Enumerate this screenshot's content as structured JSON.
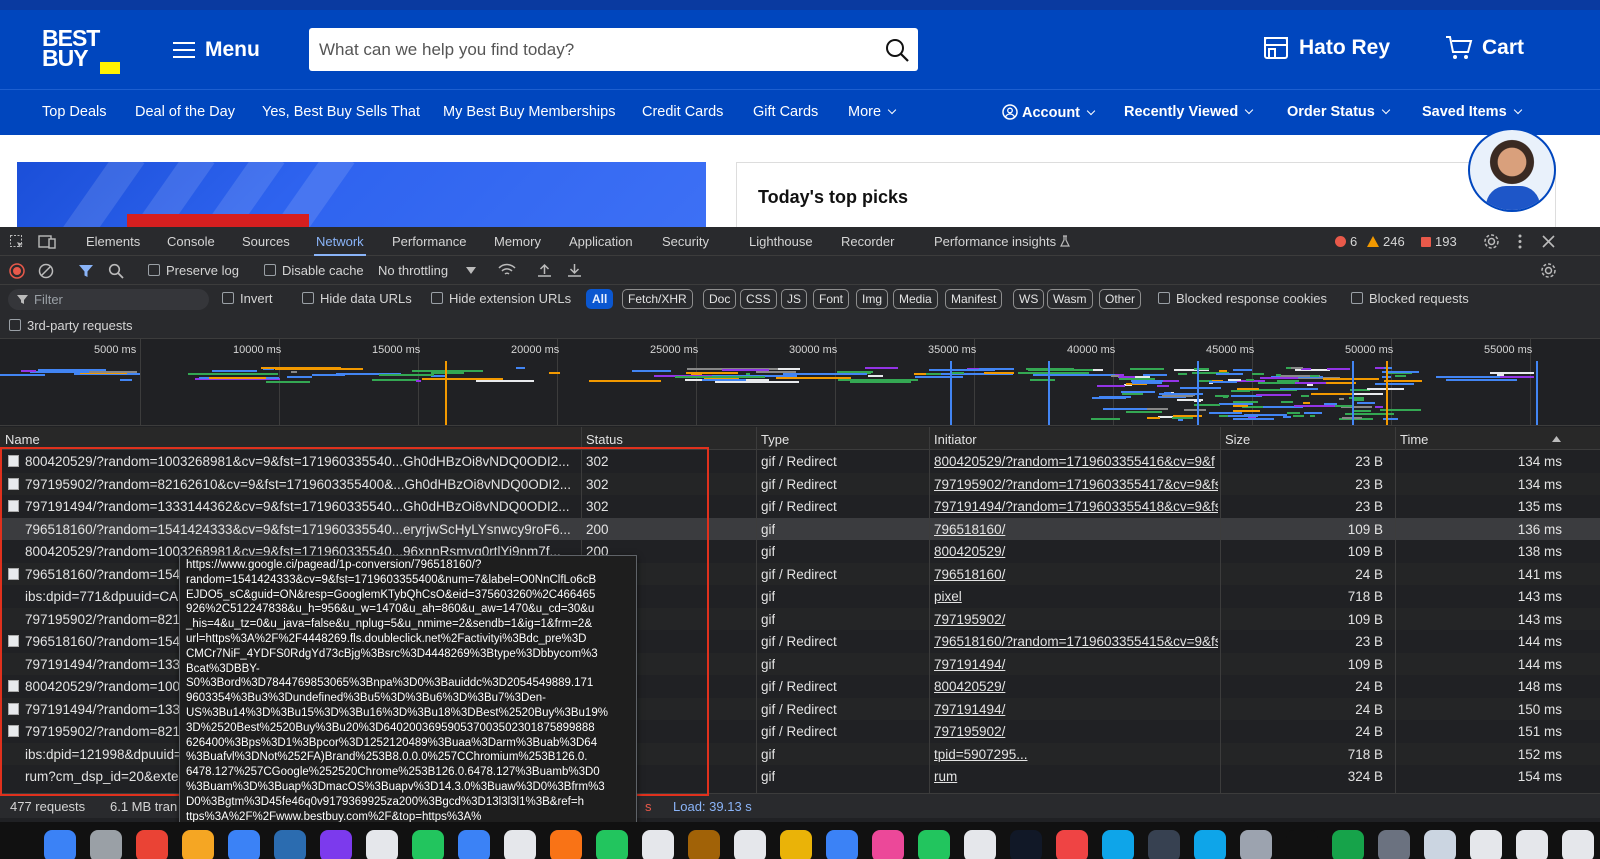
{
  "site": {
    "logo_line1": "BEST",
    "logo_line2": "BUY",
    "menu_label": "Menu",
    "search_placeholder": "What can we help you find today?",
    "store_label": "Hato Rey",
    "cart_label": "Cart",
    "nav_items": [
      "Top Deals",
      "Deal of the Day",
      "Yes, Best Buy Sells That",
      "My Best Buy Memberships",
      "Credit Cards",
      "Gift Cards",
      "More"
    ],
    "account_items": [
      "Account",
      "Recently Viewed",
      "Order Status",
      "Saved Items"
    ],
    "top_picks_title": "Today's top picks",
    "brand_colors": {
      "blue": "#0046be",
      "yellow": "#fff200"
    }
  },
  "devtools": {
    "tabs": [
      "Elements",
      "Console",
      "Sources",
      "Network",
      "Performance",
      "Memory",
      "Application",
      "Security",
      "Lighthouse",
      "Recorder",
      "Performance insights"
    ],
    "active_tab": "Network",
    "counts": {
      "errors": "6",
      "warnings": "246",
      "issues": "193"
    },
    "toolbar": {
      "preserve_log": "Preserve log",
      "disable_cache": "Disable cache",
      "throttling": "No throttling"
    },
    "filter": {
      "placeholder": "Filter",
      "invert": "Invert",
      "hide_data_urls": "Hide data URLs",
      "hide_extension_urls": "Hide extension URLs",
      "types": [
        "All",
        "Fetch/XHR",
        "Doc",
        "CSS",
        "JS",
        "Font",
        "Img",
        "Media",
        "Manifest",
        "WS",
        "Wasm",
        "Other"
      ],
      "active_type": "All",
      "blocked_response_cookies": "Blocked response cookies",
      "blocked_requests": "Blocked requests",
      "third_party": "3rd-party requests"
    },
    "overview_ticks": [
      "5000 ms",
      "10000 ms",
      "15000 ms",
      "20000 ms",
      "25000 ms",
      "30000 ms",
      "35000 ms",
      "40000 ms",
      "45000 ms",
      "50000 ms",
      "55000 ms"
    ],
    "columns": {
      "name": "Name",
      "status": "Status",
      "type": "Type",
      "initiator": "Initiator",
      "size": "Size",
      "time": "Time"
    },
    "rows": [
      {
        "name": "800420529/?random=1003268981&cv=9&fst=171960335540...Gh0dHBzOi8vNDQ0ODI2...",
        "status": "302",
        "type": "gif / Redirect",
        "initiator": "800420529/?random=1719603355416&cv=9&f",
        "size": "23 B",
        "time": "134 ms",
        "icon": true
      },
      {
        "name": "797195902/?random=82162610&cv=9&fst=1719603355400&...Gh0dHBzOi8vNDQ0ODI2...",
        "status": "302",
        "type": "gif / Redirect",
        "initiator": "797195902/?random=1719603355417&cv=9&fs",
        "size": "23 B",
        "time": "134 ms",
        "icon": true
      },
      {
        "name": "797191494/?random=1333144362&cv=9&fst=171960335540...Gh0dHBzOi8vNDQ0ODI2...",
        "status": "302",
        "type": "gif / Redirect",
        "initiator": "797191494/?random=1719603355418&cv=9&fs",
        "size": "23 B",
        "time": "135 ms",
        "icon": true
      },
      {
        "name": "796518160/?random=1541424333&cv=9&fst=171960335540...eryrjwScHyLYsnwcy9roF6...",
        "status": "200",
        "type": "gif",
        "initiator": "796518160/",
        "size": "109 B",
        "time": "136 ms",
        "icon": false
      },
      {
        "name": "800420529/?random=1003268981&cv=9&fst=171960335540...96xnnRsmvq0rtlYi9nm7f...",
        "status": "200",
        "type": "gif",
        "initiator": "800420529/",
        "size": "109 B",
        "time": "138 ms",
        "icon": false
      },
      {
        "name": "796518160/?random=154",
        "status": "",
        "type": "gif / Redirect",
        "initiator": "796518160/",
        "size": "24 B",
        "time": "141 ms",
        "icon": true
      },
      {
        "name": "ibs:dpid=771&dpuuid=CA",
        "status": "",
        "type": "gif",
        "initiator": "pixel",
        "size": "718 B",
        "time": "143 ms",
        "icon": false
      },
      {
        "name": "797195902/?random=821",
        "status": "",
        "type": "gif",
        "initiator": "797195902/",
        "size": "109 B",
        "time": "143 ms",
        "icon": false
      },
      {
        "name": "796518160/?random=154",
        "status": "",
        "type": "gif / Redirect",
        "initiator": "796518160/?random=1719603355415&cv=9&fs",
        "size": "23 B",
        "time": "144 ms",
        "icon": true
      },
      {
        "name": "797191494/?random=133",
        "status": "",
        "type": "gif",
        "initiator": "797191494/",
        "size": "109 B",
        "time": "144 ms",
        "icon": false
      },
      {
        "name": "800420529/?random=100",
        "status": "",
        "type": "gif / Redirect",
        "initiator": "800420529/",
        "size": "24 B",
        "time": "148 ms",
        "icon": true
      },
      {
        "name": "797191494/?random=133",
        "status": "",
        "type": "gif / Redirect",
        "initiator": "797191494/",
        "size": "24 B",
        "time": "150 ms",
        "icon": true
      },
      {
        "name": "797195902/?random=821",
        "status": "",
        "type": "gif / Redirect",
        "initiator": "797195902/",
        "size": "24 B",
        "time": "151 ms",
        "icon": true
      },
      {
        "name": "ibs:dpid=121998&dpuuid=",
        "status": "",
        "type": "gif",
        "initiator": "tpid=5907295...",
        "size": "718 B",
        "time": "152 ms",
        "icon": false
      },
      {
        "name": "rum?cm_dsp_id=20&exte",
        "status": "",
        "type": "gif",
        "initiator": "rum",
        "size": "324 B",
        "time": "154 ms",
        "icon": false
      }
    ],
    "tooltip_lines": [
      "https://www.google.ci/pagead/1p-conversion/796518160/?",
      "random=1541424333&cv=9&fst=1719603355400&num=7&label=O0NnClfLo6cB",
      "EJDO5_sC&guid=ON&resp=GooglemKTybQhCsO&eid=375603260%2C466465",
      "926%2C512247838&u_h=956&u_w=1470&u_ah=860&u_aw=1470&u_cd=30&u",
      "_his=4&u_tz=0&u_java=false&u_nplug=5&u_nmime=2&sendb=1&ig=1&frm=2&",
      "url=https%3A%2F%2F4448269.fls.doubleclick.net%2Factivityi%3Bdc_pre%3D",
      "CMCr7NiF_4YDFS0RdgYd73cBjg%3Bsrc%3D4448269%3Btype%3Dbbycom%3",
      "Bcat%3DBBY-",
      "S0%3Bord%3D7844769853065%3Bnpa%3D0%3Bauiddc%3D2054549889.171",
      "9603354%3Bu3%3Dundefined%3Bu5%3D%3Bu6%3D%3Bu7%3Den-",
      "US%3Bu14%3D%3Bu15%3D%3Bu16%3D%3Bu18%3DBest%2520Buy%3Bu19%",
      "3D%2520Best%2520Buy%3Bu20%3D640200369590537003502301875899888",
      "626400%3Bps%3D1%3Bpcor%3D1252120489%3Buaa%3Darm%3Buab%3D64",
      "%3Buafvl%3DNot%252FA)Brand%253B8.0.0.0%257CChromium%253B126.0.",
      "6478.127%257CGoogle%252520Chrome%253B126.0.6478.127%3Buamb%3D0",
      "%3Buam%3D%3Buap%3DmacOS%3Buapv%3D14.3.0%3Buaw%3D0%3Bfrm%3",
      "D0%3Bgtm%3D45fe46q0v9179369925za200%3Bgcd%3D13l3l3l1%3B&ref=h",
      "ttps%3A%2F%2Fwww.bestbuy.com%2F&top=https%3A%"
    ],
    "status_bar": {
      "requests": "477 requests",
      "transferred": "6.1 MB tran",
      "finish_suffix": "s",
      "load": "Load: 39.13 s"
    }
  }
}
